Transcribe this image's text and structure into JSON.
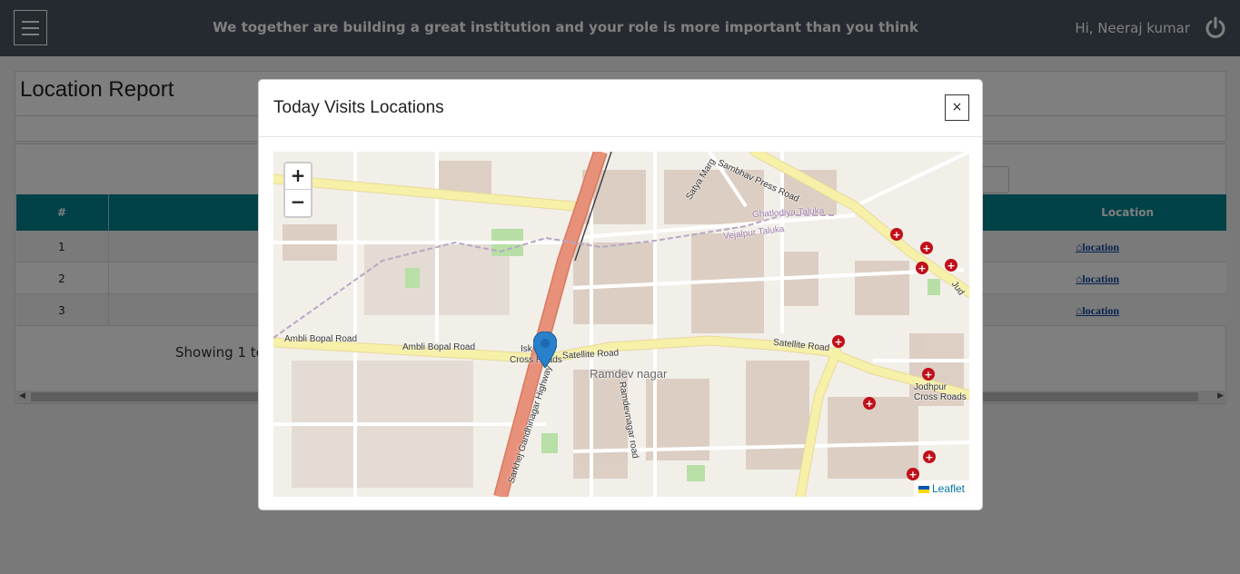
{
  "topbar": {
    "menu_icon": "hamburger-menu-icon",
    "tagline": "We together are building a great institution and your role is more important than you think",
    "greeting": "Hi, Neeraj kumar",
    "power_icon": "power-icon"
  },
  "page": {
    "title": "Location Report",
    "table": {
      "headers": {
        "num": "#",
        "location": "Location"
      },
      "rows": [
        {
          "num": "1",
          "link": "location"
        },
        {
          "num": "2",
          "link": "location"
        },
        {
          "num": "3",
          "link": "location"
        }
      ],
      "link_icon": "home-icon",
      "showing": "Showing 1 to"
    }
  },
  "modal": {
    "title": "Today Visits Locations",
    "close_label": "×",
    "map": {
      "zoom_in": "+",
      "zoom_out": "−",
      "attribution": "Leaflet",
      "labels": {
        "ambli1": "Ambli Bopal Road",
        "ambli2": "Ambli Bopal Road",
        "satellite1": "Satellite Road",
        "satellite2": "Satellite Road",
        "ramdev": "Ramdev nagar",
        "isk": "Isk",
        "cross": "Cross Roads",
        "jodhpur1": "Jodhpur",
        "jodhpur2": "Cross Roads",
        "ghatlodiya": "Ghatlodiya Taluka",
        "vejalpur": "Vejalpur Taluka",
        "satya": "Satya Marg",
        "sambhav": "Sambhav Press Road",
        "sarkhej": "Sarkhej Gandhinagar Highway",
        "ramdevroad": "Ramdevnagar road",
        "jud": "Jud"
      },
      "colors": {
        "highway": "#e8917a",
        "primary": "#f6f0a8",
        "land": "#f2efe9",
        "building": "#d9c9bd",
        "park": "#b8dfa6"
      }
    }
  }
}
